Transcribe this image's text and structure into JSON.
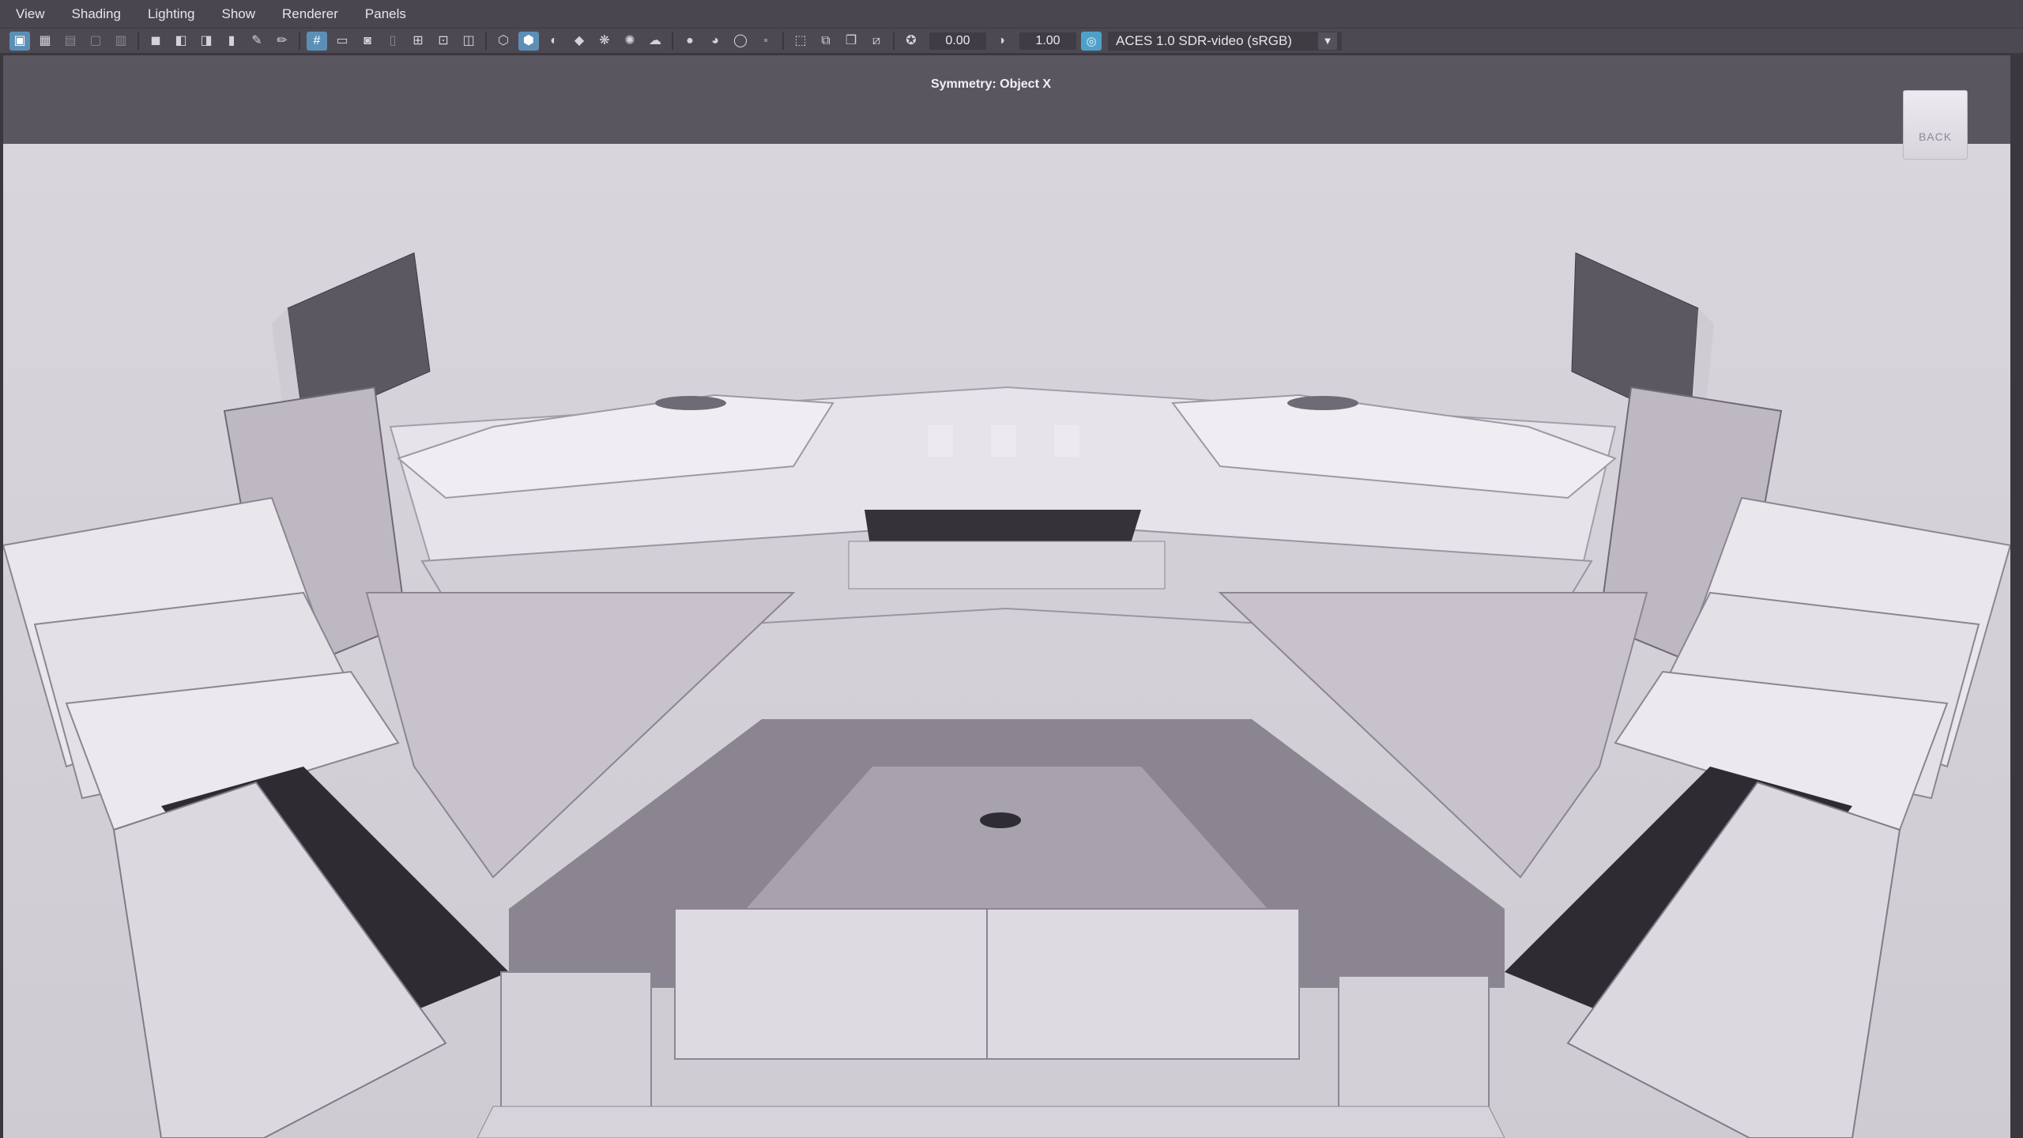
{
  "menubar": {
    "items": [
      "View",
      "Shading",
      "Lighting",
      "Show",
      "Renderer",
      "Panels"
    ]
  },
  "toolbar": {
    "exposure_value": "0.00",
    "gamma_value": "1.00",
    "color_management": "ACES 1.0 SDR-video (sRGB)"
  },
  "viewport": {
    "symmetry_label": "Symmetry: Object X",
    "viewcube_face": "BACK"
  },
  "colors": {
    "accent_active": "#5c8fb6",
    "colorspace_icon": "#4fa0c8"
  }
}
